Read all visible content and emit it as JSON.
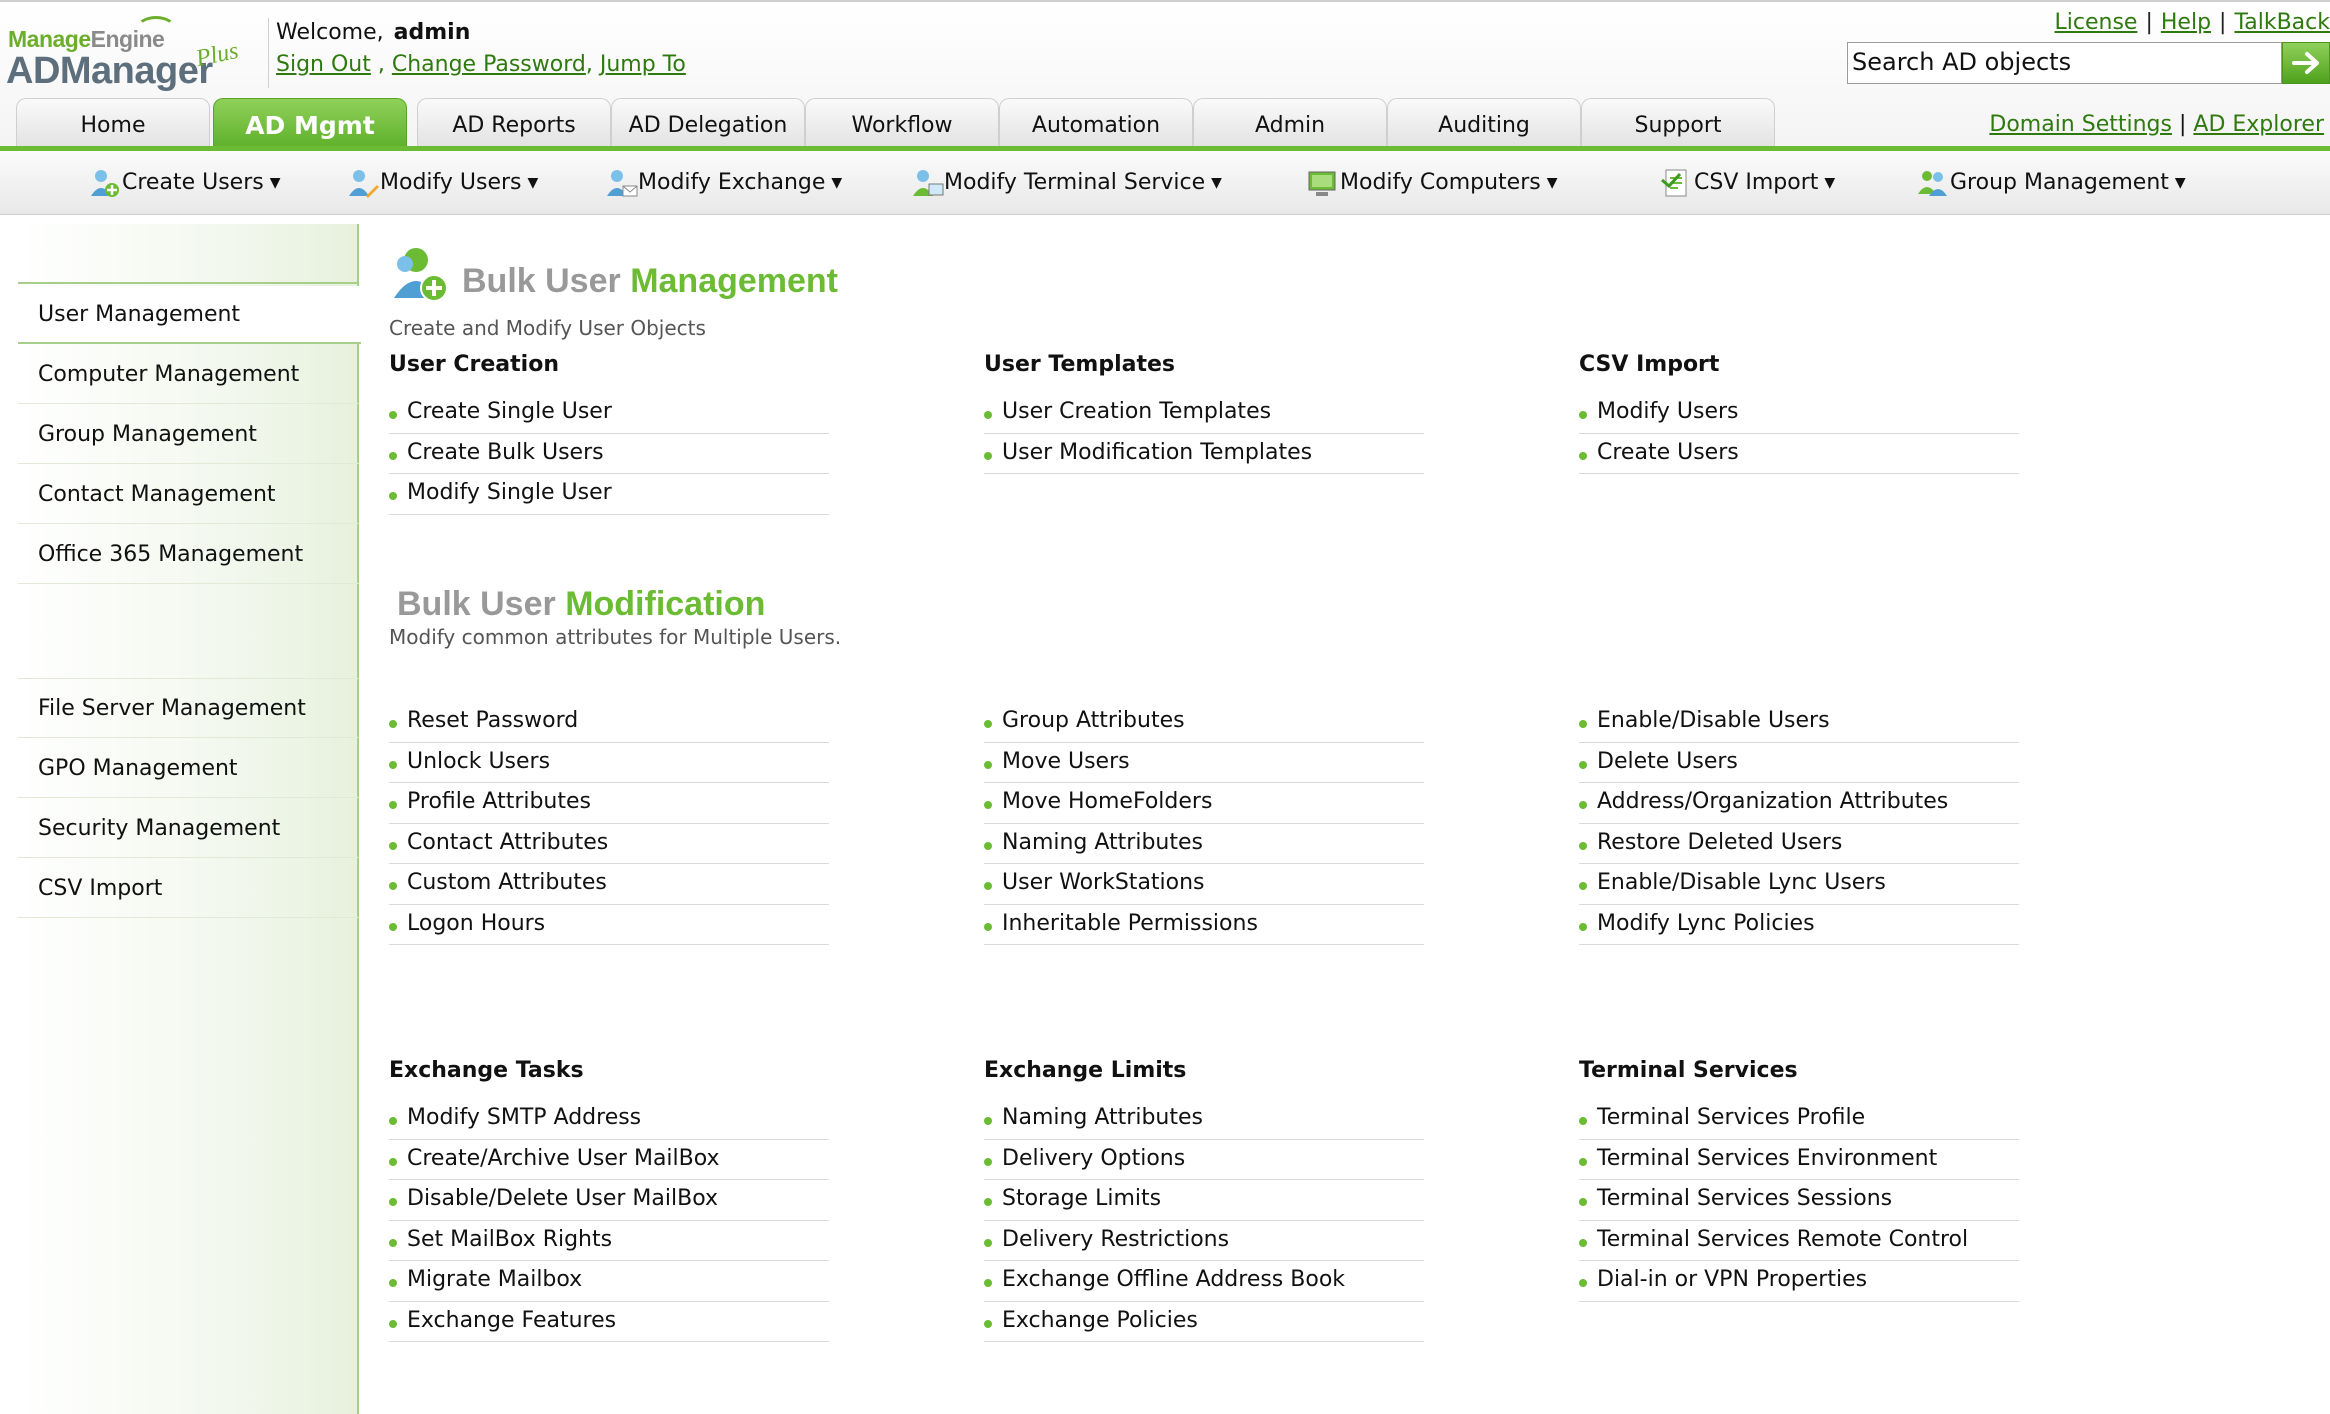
{
  "logo": {
    "brand_top_a": "Manage",
    "brand_top_b": "Engine",
    "brand_main": "ADManager",
    "brand_plus": "Plus"
  },
  "welcome": {
    "label": "Welcome,",
    "username": "admin"
  },
  "user_links": {
    "sign_out": "Sign Out",
    "sep1": " , ",
    "change_password": "Change Password",
    "sep2": ", ",
    "jump_to": "Jump To"
  },
  "top_links": {
    "license": "License",
    "help": "Help",
    "talkback": "TalkBack",
    "sep": "|"
  },
  "search": {
    "value": "Search AD objects"
  },
  "tabs": [
    "Home",
    "AD Mgmt",
    "AD Reports",
    "AD Delegation",
    "Workflow",
    "Automation",
    "Admin",
    "Auditing",
    "Support"
  ],
  "active_tab": "AD Mgmt",
  "domain_links": {
    "domain_settings": "Domain Settings",
    "sep": "|",
    "ad_explorer": "AD Explorer"
  },
  "sub_toolbar": [
    "Create Users",
    "Modify Users",
    "Modify Exchange",
    "Modify Terminal Service",
    "Modify Computers",
    "CSV Import",
    "Group Management"
  ],
  "sidebar": {
    "items": [
      "User Management",
      "Computer Management",
      "Group Management",
      "Contact Management",
      "Office 365 Management"
    ],
    "items2": [
      "File Server Management",
      "GPO Management",
      "Security Management",
      "CSV Import"
    ],
    "active": "User Management"
  },
  "bulk_mgmt": {
    "title_a": "Bulk User ",
    "title_b": "Management",
    "subtitle": "Create and Modify User Objects",
    "groups": [
      {
        "heading": "User Creation",
        "items": [
          "Create Single User",
          "Create Bulk Users",
          "Modify Single User"
        ]
      },
      {
        "heading": "User Templates",
        "items": [
          "User Creation Templates",
          "User Modification Templates"
        ]
      },
      {
        "heading": "CSV Import",
        "items": [
          "Modify Users",
          "Create Users"
        ]
      }
    ]
  },
  "bulk_mod": {
    "title_a": "Bulk User ",
    "title_b": "Modification",
    "subtitle": "Modify common attributes for Multiple Users.",
    "columns": [
      [
        "Reset Password",
        "Unlock Users",
        "Profile Attributes",
        "Contact Attributes",
        "Custom Attributes",
        "Logon Hours"
      ],
      [
        "Group Attributes",
        "Move Users",
        "Move HomeFolders",
        "Naming Attributes",
        "User WorkStations",
        "Inheritable Permissions"
      ],
      [
        "Enable/Disable Users",
        "Delete Users",
        "Address/Organization Attributes",
        "Restore Deleted Users",
        "Enable/Disable Lync Users",
        "Modify Lync Policies"
      ]
    ]
  },
  "lower": {
    "groups": [
      {
        "heading": "Exchange Tasks",
        "items": [
          "Modify SMTP Address",
          "Create/Archive User MailBox",
          "Disable/Delete User MailBox",
          "Set MailBox Rights",
          "Migrate Mailbox",
          "Exchange Features"
        ]
      },
      {
        "heading": "Exchange Limits",
        "items": [
          "Naming Attributes",
          "Delivery Options",
          "Storage Limits",
          "Delivery Restrictions",
          "Exchange Offline Address Book",
          "Exchange Policies"
        ]
      },
      {
        "heading": "Terminal Services",
        "items": [
          "Terminal Services Profile",
          "Terminal Services Environment",
          "Terminal Services Sessions",
          "Terminal Services Remote Control",
          "Dial-in or VPN Properties"
        ]
      }
    ]
  },
  "colors": {
    "accent": "#6cbb34",
    "link": "#2f7a0f",
    "title_gray": "#999999"
  }
}
